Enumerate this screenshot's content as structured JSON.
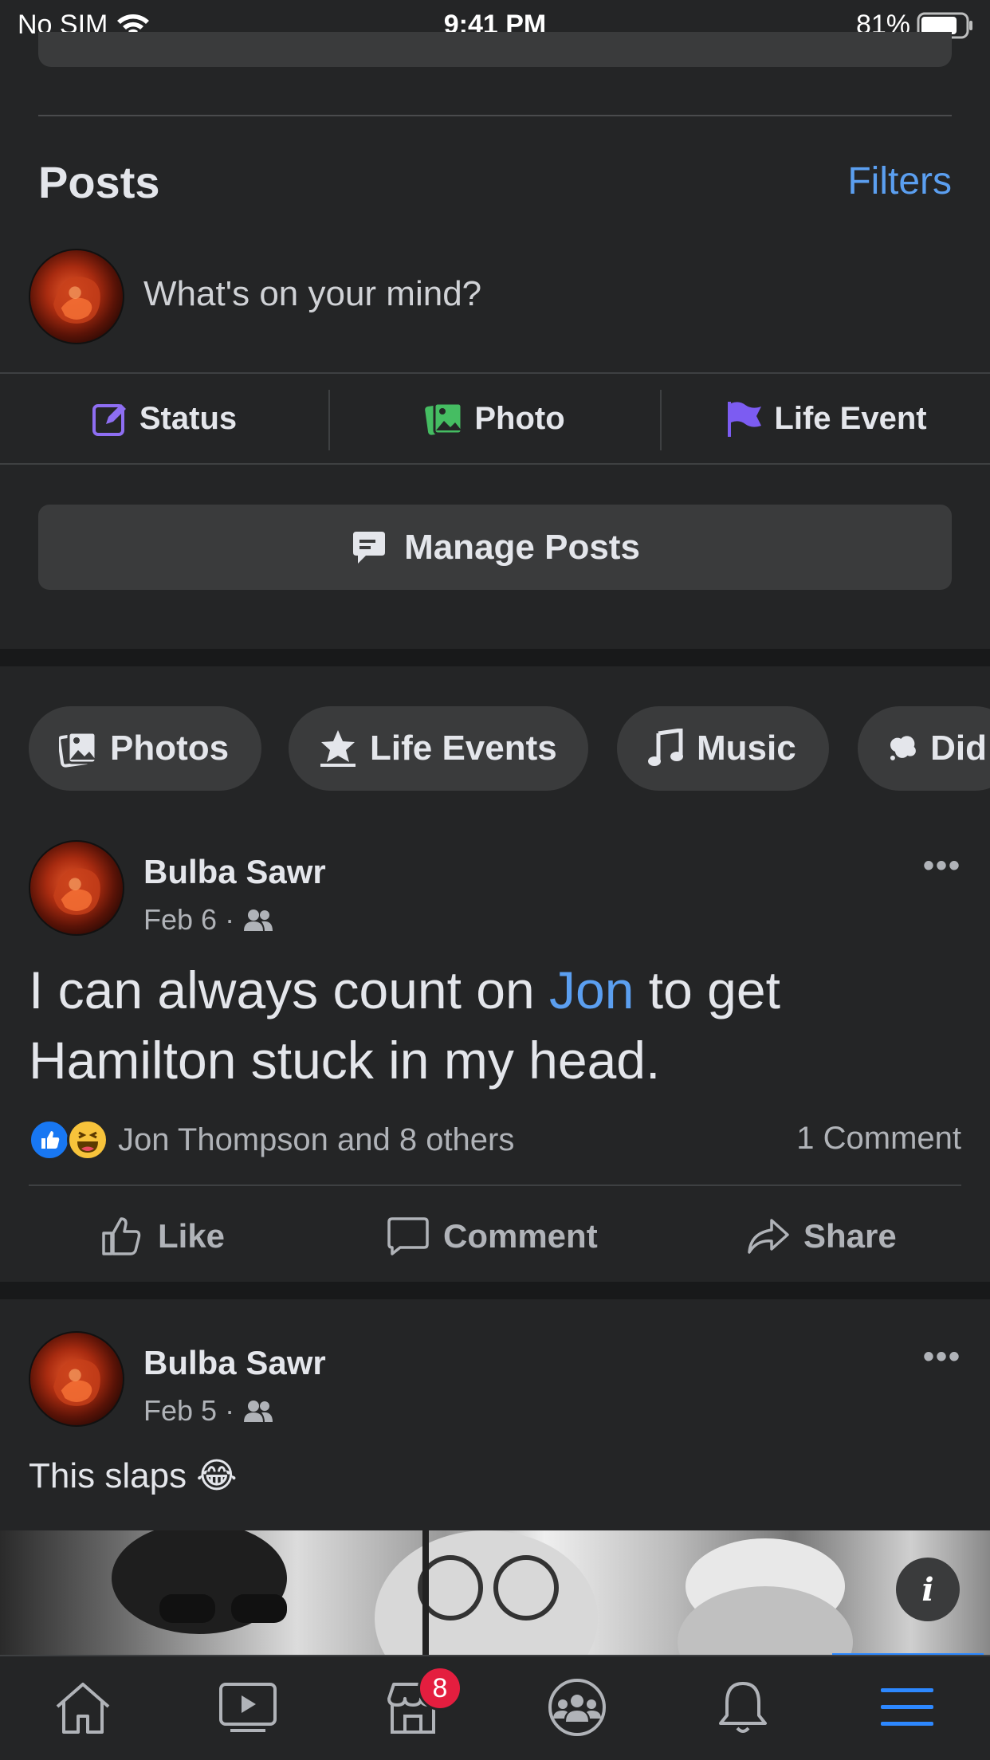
{
  "status_bar": {
    "carrier": "No SIM",
    "time": "9:41 PM",
    "battery": "81%",
    "battery_level": 0.81
  },
  "posts_section": {
    "title": "Posts",
    "filters_label": "Filters"
  },
  "composer": {
    "placeholder": "What's on your mind?",
    "actions": [
      {
        "label": "Status",
        "icon": "edit-square-icon",
        "color": "#8e6ef2"
      },
      {
        "label": "Photo",
        "icon": "photo-icon",
        "color": "#45bd62"
      },
      {
        "label": "Life Event",
        "icon": "flag-icon",
        "color": "#7c5cf2"
      }
    ],
    "manage_posts_label": "Manage Posts"
  },
  "chips": [
    {
      "label": "Photos",
      "icon": "photos-icon"
    },
    {
      "label": "Life Events",
      "icon": "star-icon"
    },
    {
      "label": "Music",
      "icon": "music-note-icon"
    },
    {
      "label": "Did",
      "icon": "thought-bubble-icon"
    }
  ],
  "posts": [
    {
      "author": "Bulba Sawr",
      "date": "Feb 6",
      "text_before": "I can always count on ",
      "mention": "Jon",
      "text_after": " to get Hamilton stuck in my head.",
      "reactions_text": "Jon Thompson and 8 others",
      "comments_text": "1 Comment",
      "actions": {
        "like": "Like",
        "comment": "Comment",
        "share": "Share"
      }
    },
    {
      "author": "Bulba Sawr",
      "date": "Feb 5",
      "text": "This slaps",
      "emoji": "😂"
    }
  ],
  "tab_bar": {
    "items": [
      "home-icon",
      "video-icon",
      "marketplace-icon",
      "groups-icon",
      "notifications-icon",
      "menu-icon"
    ],
    "marketplace_badge": "8",
    "active_color": "#2d88ff"
  }
}
